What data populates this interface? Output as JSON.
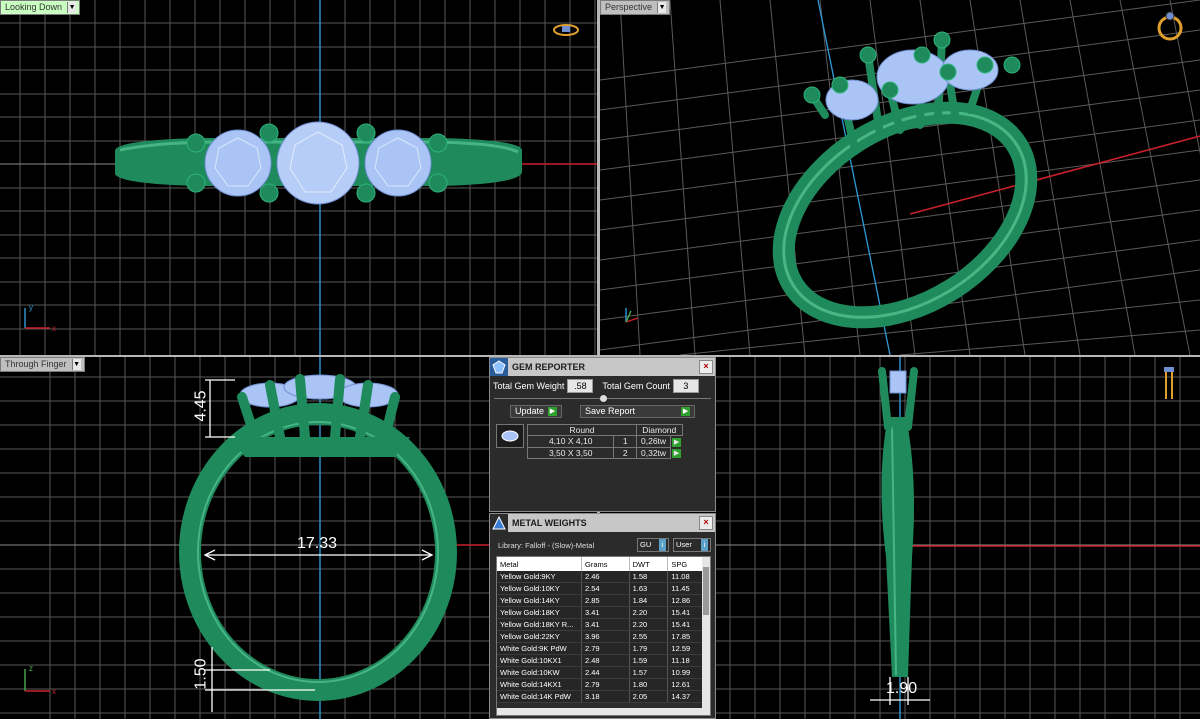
{
  "viewports": {
    "top_left": {
      "label": "Looking Down"
    },
    "top_right": {
      "label": "Perspective"
    },
    "bottom_left": {
      "label": "Through Finger"
    },
    "bottom_right": {
      "label": ""
    }
  },
  "dimensions": {
    "height_top": "4.45",
    "inner_diameter": "17.33",
    "band_thickness": "1.50",
    "band_width": "1.90"
  },
  "axis_labels": {
    "x": "x",
    "y": "y",
    "z": "z"
  },
  "gem_reporter": {
    "title": "GEM REPORTER",
    "total_weight_label": "Total Gem Weight",
    "total_weight_value": ".58",
    "total_count_label": "Total Gem Count",
    "total_count_value": "3",
    "update_label": "Update",
    "save_label": "Save Report",
    "header_shape": "Round",
    "header_stone": "Diamond",
    "rows": [
      {
        "size": "4,10 X 4,10",
        "count": "1",
        "weight": "0,26tw"
      },
      {
        "size": "3,50 X 3,50",
        "count": "2",
        "weight": "0,32tw"
      }
    ]
  },
  "metal_weights": {
    "title": "METAL WEIGHTS",
    "library": "Library: Falloff - (Slow)-Metal",
    "gu_label": "GU",
    "user_label": "User",
    "columns": [
      "Metal",
      "Grams",
      "DWT",
      "SPG"
    ],
    "rows": [
      [
        "Yellow Gold:9KY",
        "2.46",
        "1.58",
        "11.08"
      ],
      [
        "Yellow Gold:10KY",
        "2.54",
        "1.63",
        "11.45"
      ],
      [
        "Yellow Gold:14KY",
        "2.85",
        "1.84",
        "12.86"
      ],
      [
        "Yellow Gold:18KY",
        "3.41",
        "2.20",
        "15.41"
      ],
      [
        "Yellow Gold:18KY R...",
        "3.41",
        "2.20",
        "15.41"
      ],
      [
        "Yellow Gold:22KY",
        "3.96",
        "2.55",
        "17.85"
      ],
      [
        "White Gold:9K PdW",
        "2.79",
        "1.79",
        "12.59"
      ],
      [
        "White Gold:10KX1",
        "2.48",
        "1.59",
        "11.18"
      ],
      [
        "White Gold:10KW",
        "2.44",
        "1.57",
        "10.99"
      ],
      [
        "White Gold:14KX1",
        "2.79",
        "1.80",
        "12.61"
      ],
      [
        "White Gold:14K PdW",
        "3.18",
        "2.05",
        "14.37"
      ]
    ]
  },
  "colors": {
    "metal": "#1f8a5c",
    "gem": "#a9c4f5",
    "grid": "#5a5a5a",
    "x_axis": "#c8202a",
    "y_axis": "#2e9bd6"
  }
}
